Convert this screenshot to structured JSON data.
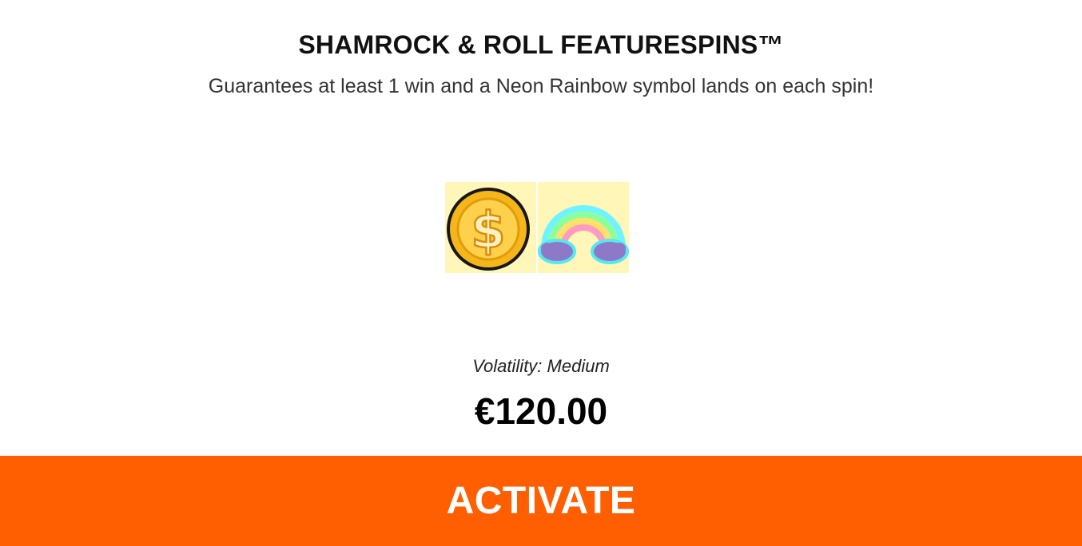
{
  "offer": {
    "title": "SHAMROCK & ROLL FEATURESPINS™",
    "description": "Guarantees at least 1 win and a Neon Rainbow symbol lands on each spin!",
    "symbols": [
      {
        "icon": "coin-icon"
      },
      {
        "icon": "neon-rainbow-icon"
      }
    ],
    "volatility_label": "Volatility: Medium",
    "price": "€120.00"
  },
  "action": {
    "activate_label": "ACTIVATE"
  },
  "colors": {
    "accent": "#ff5f00",
    "tile_background": "#fff6b8",
    "coin": "#f4b61a"
  }
}
